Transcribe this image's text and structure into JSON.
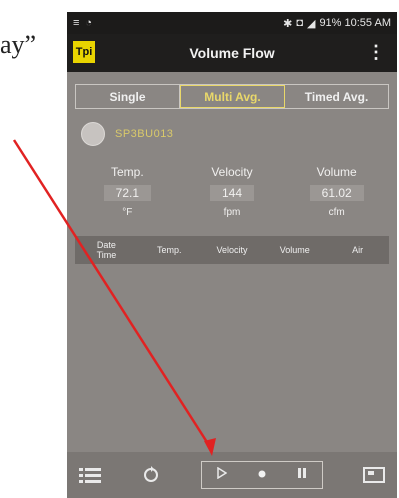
{
  "caption": {
    "side_text": "ay”"
  },
  "status_bar": {
    "right_text": "91% 10:55 AM"
  },
  "app_bar": {
    "logo_text": "Tpi",
    "title": "Volume Flow",
    "menu_icon": "more-vert-icon"
  },
  "tabs": [
    {
      "label": "Single",
      "active": false
    },
    {
      "label": "Multi Avg.",
      "active": true
    },
    {
      "label": "Timed Avg.",
      "active": false
    }
  ],
  "sensor": {
    "id_text": "SP3BU013"
  },
  "readings": [
    {
      "label": "Temp.",
      "value": "72.1",
      "unit": "°F"
    },
    {
      "label": "Velocity",
      "value": "144",
      "unit": "fpm"
    },
    {
      "label": "Volume",
      "value": "61.02",
      "unit": "cfm"
    }
  ],
  "table_header": [
    "Date\nTime",
    "Temp.",
    "Velocity",
    "Volume",
    "Air"
  ],
  "bottom_bar": {
    "icons": [
      "list-icon",
      "refresh-icon",
      "play-icon",
      "record-icon",
      "pause-icon",
      "save-icon"
    ]
  },
  "colors": {
    "accent": "#e9d86a",
    "arrow": "#e12222",
    "logo_bg": "#e9d400"
  }
}
